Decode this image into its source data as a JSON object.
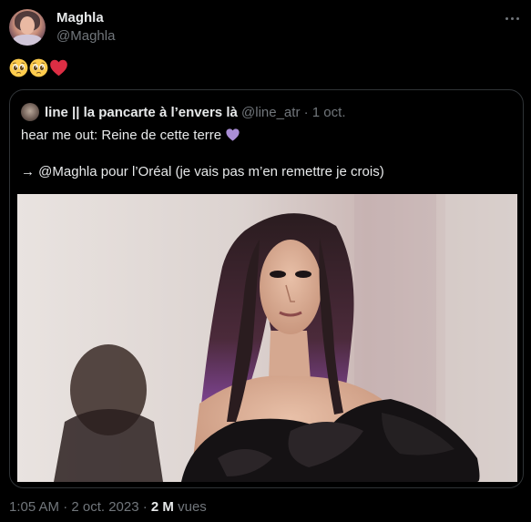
{
  "author": {
    "display_name": "Maghla",
    "handle": "@Maghla",
    "avatar_icon": "user-avatar"
  },
  "tweet": {
    "emoji_icons": [
      "pleading-face-emoji",
      "pleading-face-emoji",
      "red-heart-emoji"
    ]
  },
  "quoted": {
    "name": "line || la pancarte à l’envers là",
    "handle": "@line_atr",
    "separator": " · ",
    "date": "1 oct.",
    "line1": "hear me out: Reine de cette terre ",
    "line1_icon": "purple-heart-emoji",
    "line3": "→ @Maghla pour l’Oréal (je vais pas m’en remettre je crois)",
    "media_icon": "runway-photo"
  },
  "meta": {
    "time_date": "1:05 AM · 2 oct. 2023 · ",
    "views_count": "2 M",
    "views_label": " vues"
  },
  "colors": {
    "background": "#000000",
    "text": "#e7e9ea",
    "secondary": "#71767b",
    "border": "#2f3336",
    "heart_red": "#f91880",
    "heart_purple": "#aa8ed6"
  }
}
